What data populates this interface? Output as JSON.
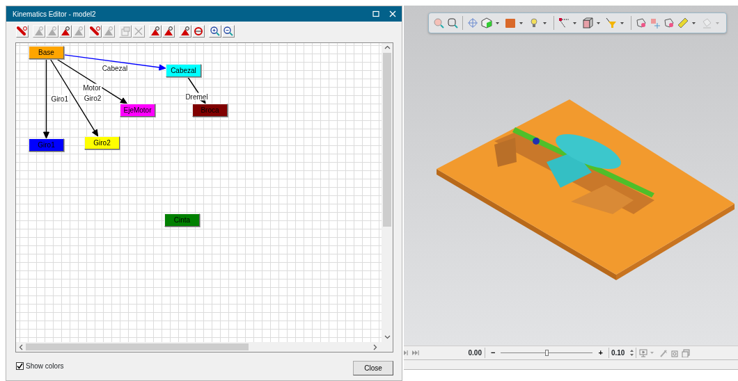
{
  "dialog": {
    "title": "Kinematics Editor -  model2",
    "toolbar_groups": [
      [
        {
          "kind": "new-link",
          "disabled": false
        }
      ],
      [
        {
          "kind": "arm",
          "disabled": true
        },
        {
          "kind": "arm",
          "disabled": true
        },
        {
          "kind": "arm",
          "disabled": false
        },
        {
          "kind": "arm",
          "disabled": true
        }
      ],
      [
        {
          "kind": "new-link",
          "disabled": false
        },
        {
          "kind": "arm",
          "disabled": true
        }
      ],
      [
        {
          "kind": "properties",
          "disabled": true
        },
        {
          "kind": "delete",
          "disabled": true
        }
      ],
      [
        {
          "kind": "arm",
          "disabled": false
        },
        {
          "kind": "arm",
          "disabled": false
        }
      ],
      [
        {
          "kind": "arm",
          "disabled": false
        },
        {
          "kind": "cycle",
          "disabled": false
        }
      ],
      [
        {
          "kind": "zoom-in",
          "disabled": false
        },
        {
          "kind": "zoom-out",
          "disabled": false
        }
      ]
    ],
    "nodes": [
      {
        "label": "Base",
        "color": "#ffa500",
        "children": [
          {
            "label": "Giro1",
            "color": "#0000ff",
            "joint": {
              "label": "Giro1",
              "color": "#000000"
            }
          },
          {
            "label": "Giro2",
            "color": "#ffff00",
            "joint": {
              "label": "Giro2",
              "color": "#000000"
            }
          },
          {
            "label": "EjeMotor",
            "color": "#ff00ff",
            "joint": {
              "label": "Motor",
              "color": "#000000"
            }
          },
          {
            "label": "Cabezal",
            "color": "#00ffff",
            "joint": {
              "label": "Cabezal",
              "color": "#0000ff"
            },
            "children": [
              {
                "label": "Broca",
                "color": "#800000",
                "joint": {
                  "label": "Dremel",
                  "color": "#000000"
                }
              }
            ]
          }
        ]
      },
      {
        "label": "Cinta",
        "color": "#008000"
      }
    ],
    "show_colors": {
      "label": "Show colors",
      "checked": true
    },
    "close_button": "Close"
  },
  "viewport": {
    "kind": "picture",
    "toolbar_groups": [
      [
        {
          "kind": "zoom",
          "dropdown": false,
          "disabled": false
        },
        {
          "kind": "zoom-window",
          "dropdown": false,
          "disabled": false
        }
      ],
      [
        {
          "kind": "crosshair",
          "dropdown": false,
          "disabled": false
        },
        {
          "kind": "cube",
          "dropdown": true,
          "disabled": false
        },
        {
          "kind": "solid",
          "dropdown": true,
          "disabled": false
        },
        {
          "kind": "bulb",
          "dropdown": true,
          "disabled": false
        }
      ],
      [
        {
          "kind": "line",
          "dropdown": true,
          "disabled": false
        },
        {
          "kind": "box",
          "dropdown": true,
          "disabled": false
        },
        {
          "kind": "funnel",
          "dropdown": true,
          "disabled": false
        }
      ],
      [
        {
          "kind": "shape",
          "dropdown": false,
          "disabled": false
        },
        {
          "kind": "move",
          "dropdown": false,
          "disabled": false
        },
        {
          "kind": "shape",
          "dropdown": false,
          "disabled": false
        },
        {
          "kind": "ruler",
          "dropdown": true,
          "disabled": false
        },
        {
          "kind": "bucket",
          "dropdown": true,
          "disabled": true
        }
      ]
    ]
  },
  "player": {
    "time": "0.00",
    "minus": "−",
    "plus": "+",
    "slider": {
      "level": 0.5
    },
    "step": "0.10"
  }
}
